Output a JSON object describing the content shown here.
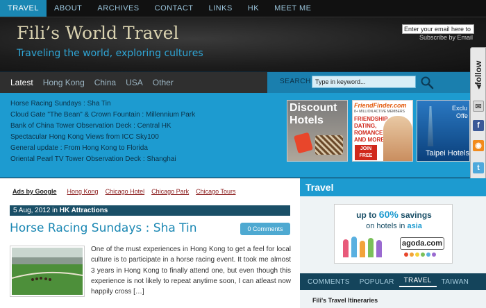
{
  "topnav": {
    "items": [
      "TRAVEL",
      "ABOUT",
      "ARCHIVES",
      "CONTACT",
      "LINKS",
      "HK",
      "MEET ME"
    ]
  },
  "header": {
    "title": "Fili’s World Travel",
    "tagline": "Traveling the world, exploring cultures",
    "email_value": "Enter your email here to s",
    "subscribe_label": "Subscribe by Email"
  },
  "follow": {
    "label": "◂follow",
    "icons": [
      "mail-icon",
      "facebook-icon",
      "rss-icon",
      "twitter-icon"
    ]
  },
  "featured": {
    "tabs": [
      "Latest",
      "Hong Kong",
      "China",
      "USA",
      "Other"
    ],
    "search_label": "SEARCH",
    "search_value": "Type in keyword...",
    "links": [
      "Horse Racing Sundays : Sha Tin",
      "Cloud Gate \"The Bean\" & Crown Fountain : Millennium Park",
      "Bank of China Tower Observation Deck : Central HK",
      "Spectacular Hong Kong Views from ICC Sky100",
      "General update : From Hong Kong to Florida",
      "Oriental Pearl TV Tower Observation Deck : Shanghai"
    ],
    "ads": {
      "discount": {
        "line1": "Discount",
        "line2": "Hotels"
      },
      "friendfinder": {
        "brand": "FriendFinder.com",
        "members": "8+ MILLION ACTIVE MEMBERS",
        "pitch": [
          "FRIENDSHIP,",
          "DATING,",
          "ROMANCE",
          "AND MORE!"
        ],
        "cta": [
          "JOIN",
          "FREE"
        ]
      },
      "taipei": {
        "top": "Exclu",
        "top2": "Offe",
        "label": "Taipei Hotels"
      }
    }
  },
  "content": {
    "ads_by": "Ads by Google",
    "ad_links": [
      "Hong Kong",
      "Chicago Hotel",
      "Chicago Park",
      "Chicago Tours"
    ],
    "post": {
      "date": "5 Aug, 2012 in",
      "category": "HK Attractions",
      "title": "Horse Racing Sundays : Sha Tin",
      "comments": "0 Comments",
      "excerpt": "One of the must experiences in Hong Kong to get a feel for local culture is to participate in a horse racing event. It took me almost 3 years in Hong Kong to finally attend one, but even though this experience is not likely to repeat anytime soon, I can atleast now happily cross […]"
    }
  },
  "sidebar": {
    "heading": "Travel",
    "agoda": {
      "line1_pre": "up to ",
      "line1_hl": "60%",
      "line1_post": " savings",
      "line2_pre": "on hotels in ",
      "line2_hl": "asia",
      "logo": "agoda.com"
    },
    "tabs": [
      "COMMENTS",
      "POPULAR",
      "TRAVEL",
      "TAIWAN"
    ],
    "subheading": "Fili's Travel Itineraries"
  },
  "colors": {
    "accent": "#1d9bd0",
    "dark_band": "#2f2f2f",
    "tab_bar": "#14445b"
  }
}
